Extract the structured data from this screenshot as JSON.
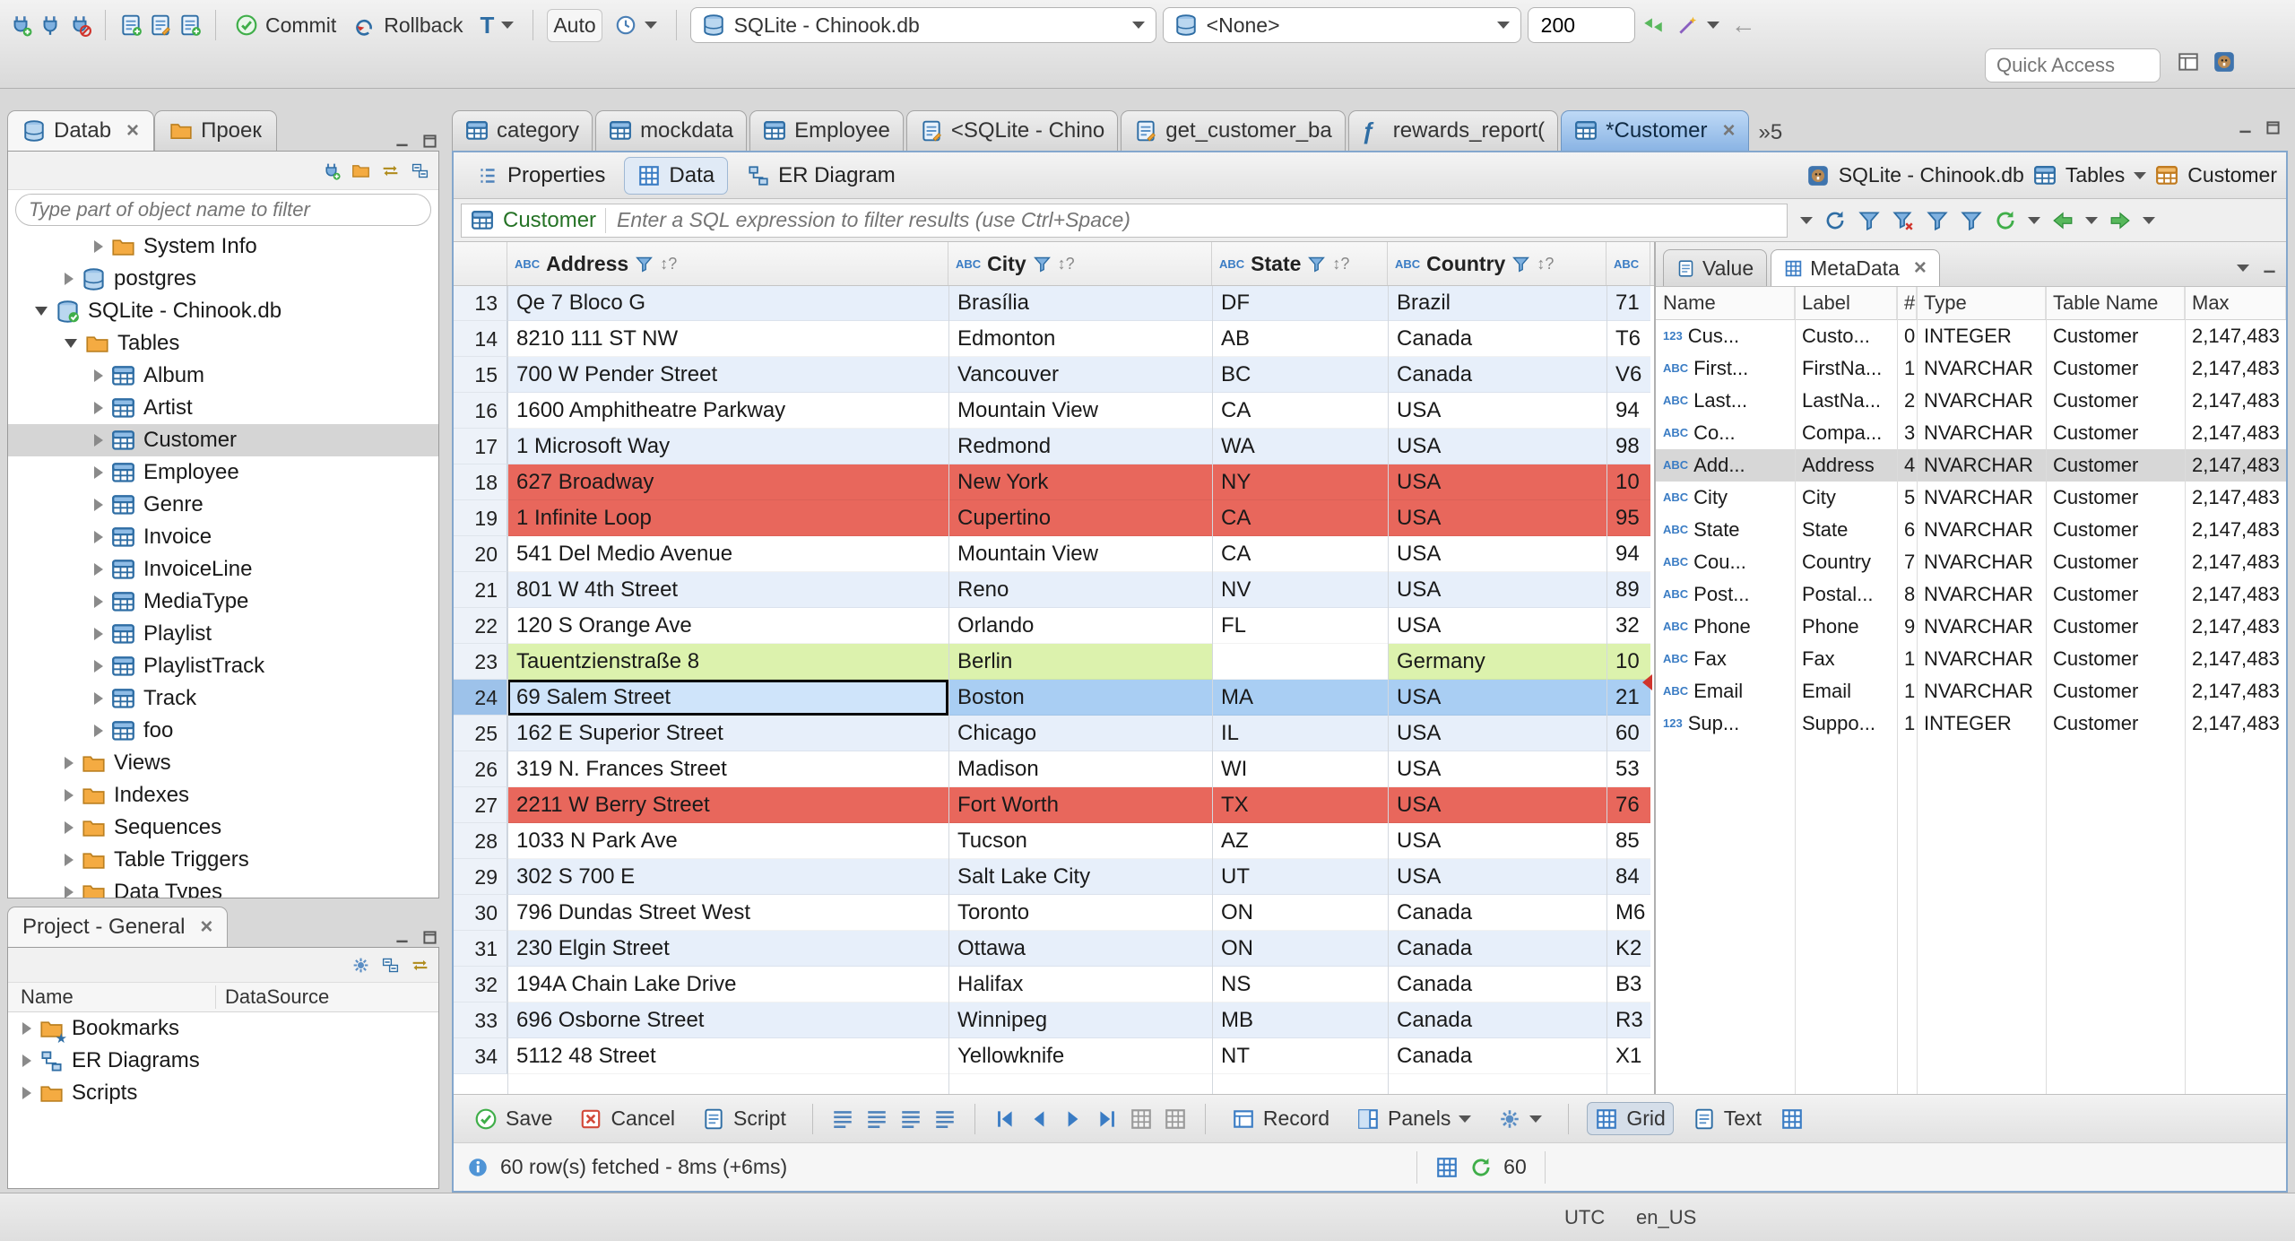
{
  "colors": {
    "accent": "#3a7cc4",
    "row_alt": "#e7effa",
    "row_red": "#e8675c",
    "row_green": "#dcf2ad",
    "row_selected": "#a9cef3",
    "focus_cell": "#cfe4fa",
    "tab_active_top": "#bed9f6",
    "tab_active_bottom": "#8ab4e4"
  },
  "window": {
    "status_items": [
      "UTC",
      "en_US"
    ]
  },
  "main_toolbar": {
    "commit": "Commit",
    "rollback": "Rollback",
    "txn_mode": "T",
    "auto_commit_mode": "Auto",
    "database": "SQLite - Chinook.db",
    "schema": "<None>",
    "fetch_size": "200",
    "quick_access_placeholder": "Quick Access"
  },
  "navigator": {
    "tab_database": "Datab",
    "tab_projects": "Проек",
    "filter_placeholder": "Type part of object name to filter",
    "tree": [
      {
        "label": "System Info",
        "icon": "folder",
        "level": 2
      },
      {
        "label": "postgres",
        "icon": "db",
        "level": 1
      },
      {
        "label": "SQLite - Chinook.db",
        "icon": "db-check",
        "level": 0,
        "expanded": true
      },
      {
        "label": "Tables",
        "icon": "folder",
        "level": 1,
        "expanded": true
      },
      {
        "label": "Album",
        "icon": "table",
        "level": 2
      },
      {
        "label": "Artist",
        "icon": "table",
        "level": 2
      },
      {
        "label": "Customer",
        "icon": "table",
        "level": 2,
        "selected": true
      },
      {
        "label": "Employee",
        "icon": "table",
        "level": 2
      },
      {
        "label": "Genre",
        "icon": "table",
        "level": 2
      },
      {
        "label": "Invoice",
        "icon": "table",
        "level": 2
      },
      {
        "label": "InvoiceLine",
        "icon": "table",
        "level": 2
      },
      {
        "label": "MediaType",
        "icon": "table",
        "level": 2
      },
      {
        "label": "Playlist",
        "icon": "table",
        "level": 2
      },
      {
        "label": "PlaylistTrack",
        "icon": "table",
        "level": 2
      },
      {
        "label": "Track",
        "icon": "table",
        "level": 2
      },
      {
        "label": "foo",
        "icon": "table",
        "level": 2
      },
      {
        "label": "Views",
        "icon": "folder",
        "level": 1
      },
      {
        "label": "Indexes",
        "icon": "folder",
        "level": 1
      },
      {
        "label": "Sequences",
        "icon": "folder",
        "level": 1
      },
      {
        "label": "Table Triggers",
        "icon": "folder",
        "level": 1
      },
      {
        "label": "Data Types",
        "icon": "folder",
        "level": 1
      }
    ]
  },
  "projects_panel": {
    "title": "Project - General",
    "columns": [
      "Name",
      "DataSource"
    ],
    "rows": [
      {
        "label": "Bookmarks",
        "icon": "folder-star"
      },
      {
        "label": "ER Diagrams",
        "icon": "diagram"
      },
      {
        "label": "Scripts",
        "icon": "folder"
      }
    ]
  },
  "editor": {
    "tabs": [
      {
        "label": "category",
        "icon": "table"
      },
      {
        "label": "mockdata",
        "icon": "table"
      },
      {
        "label": "Employee",
        "icon": "table"
      },
      {
        "label": "<SQLite - Chino",
        "icon": "sql"
      },
      {
        "label": "get_customer_ba",
        "icon": "sql"
      },
      {
        "label": "rewards_report(",
        "icon": "function"
      },
      {
        "label": "*Customer",
        "icon": "table",
        "active": true,
        "closable": true
      }
    ],
    "tab_overflow": "»5",
    "subtabs": [
      {
        "label": "Properties",
        "icon": "properties"
      },
      {
        "label": "Data",
        "icon": "grid",
        "active": true
      },
      {
        "label": "ER Diagram",
        "icon": "diagram"
      }
    ],
    "context": {
      "database": "SQLite - Chinook.db",
      "container": "Tables",
      "entity": "Customer"
    },
    "filter": {
      "entity": "Customer",
      "placeholder": "Enter a SQL expression to filter results (use Ctrl+Space)"
    }
  },
  "grid": {
    "sort_indicator": "↕?",
    "type_icons": {
      "text": "ABC",
      "number": "123"
    },
    "columns": [
      "Address",
      "City",
      "State",
      "Country",
      ""
    ],
    "rows": [
      {
        "n": 13,
        "bg": "alt",
        "cells": [
          "Qe 7 Bloco G",
          "Brasília",
          "DF",
          "Brazil",
          "71"
        ]
      },
      {
        "n": 14,
        "bg": "plain",
        "cells": [
          "8210 111 ST NW",
          "Edmonton",
          "AB",
          "Canada",
          "T6"
        ]
      },
      {
        "n": 15,
        "bg": "alt",
        "cells": [
          "700 W Pender Street",
          "Vancouver",
          "BC",
          "Canada",
          "V6"
        ]
      },
      {
        "n": 16,
        "bg": "plain",
        "cells": [
          "1600 Amphitheatre Parkway",
          "Mountain View",
          "CA",
          "USA",
          "94"
        ]
      },
      {
        "n": 17,
        "bg": "alt",
        "cells": [
          "1 Microsoft Way",
          "Redmond",
          "WA",
          "USA",
          "98"
        ]
      },
      {
        "n": 18,
        "bg": "red",
        "cells": [
          "627 Broadway",
          "New York",
          "NY",
          "USA",
          "10"
        ]
      },
      {
        "n": 19,
        "bg": "red",
        "cells": [
          "1 Infinite Loop",
          "Cupertino",
          "CA",
          "USA",
          "95"
        ]
      },
      {
        "n": 20,
        "bg": "plain",
        "cells": [
          "541 Del Medio Avenue",
          "Mountain View",
          "CA",
          "USA",
          "94"
        ]
      },
      {
        "n": 21,
        "bg": "alt",
        "cells": [
          "801 W 4th Street",
          "Reno",
          "NV",
          "USA",
          "89"
        ]
      },
      {
        "n": 22,
        "bg": "plain",
        "cells": [
          "120 S Orange Ave",
          "Orlando",
          "FL",
          "USA",
          "32"
        ]
      },
      {
        "n": 23,
        "bg": "green",
        "cells": [
          "Tauentzienstraße 8",
          "Berlin",
          "",
          "Germany",
          "10"
        ]
      },
      {
        "n": 24,
        "bg": "selected",
        "focus": 0,
        "cells": [
          "69 Salem Street",
          "Boston",
          "MA",
          "USA",
          "21"
        ]
      },
      {
        "n": 25,
        "bg": "alt",
        "cells": [
          "162 E Superior Street",
          "Chicago",
          "IL",
          "USA",
          "60"
        ]
      },
      {
        "n": 26,
        "bg": "plain",
        "cells": [
          "319 N. Frances Street",
          "Madison",
          "WI",
          "USA",
          "53"
        ]
      },
      {
        "n": 27,
        "bg": "red",
        "cells": [
          "2211 W Berry Street",
          "Fort Worth",
          "TX",
          "USA",
          "76"
        ]
      },
      {
        "n": 28,
        "bg": "plain",
        "cells": [
          "1033 N Park Ave",
          "Tucson",
          "AZ",
          "USA",
          "85"
        ]
      },
      {
        "n": 29,
        "bg": "alt",
        "cells": [
          "302 S 700 E",
          "Salt Lake City",
          "UT",
          "USA",
          "84"
        ]
      },
      {
        "n": 30,
        "bg": "plain",
        "cells": [
          "796 Dundas Street West",
          "Toronto",
          "ON",
          "Canada",
          "M6"
        ]
      },
      {
        "n": 31,
        "bg": "alt",
        "cells": [
          "230 Elgin Street",
          "Ottawa",
          "ON",
          "Canada",
          "K2"
        ]
      },
      {
        "n": 32,
        "bg": "plain",
        "cells": [
          "194A Chain Lake Drive",
          "Halifax",
          "NS",
          "Canada",
          "B3"
        ]
      },
      {
        "n": 33,
        "bg": "alt",
        "cells": [
          "696 Osborne Street",
          "Winnipeg",
          "MB",
          "Canada",
          "R3"
        ]
      },
      {
        "n": 34,
        "bg": "plain",
        "cells": [
          "5112 48 Street",
          "Yellowknife",
          "NT",
          "Canada",
          "X1"
        ]
      }
    ]
  },
  "metadata_panel": {
    "tab_value": "Value",
    "tab_metadata": "MetaData",
    "columns": [
      "Name",
      "Label",
      "#",
      "Type",
      "Table Name",
      "Max"
    ],
    "rows": [
      {
        "icon": "number",
        "name": "Cus...",
        "label": "Custo...",
        "ord": "0",
        "type": "INTEGER",
        "table": "Customer",
        "max": "2,147,483"
      },
      {
        "icon": "text",
        "name": "First...",
        "label": "FirstNa...",
        "ord": "1",
        "type": "NVARCHAR",
        "table": "Customer",
        "max": "2,147,483"
      },
      {
        "icon": "text",
        "name": "Last...",
        "label": "LastNa...",
        "ord": "2",
        "type": "NVARCHAR",
        "table": "Customer",
        "max": "2,147,483"
      },
      {
        "icon": "text",
        "name": "Co...",
        "label": "Compa...",
        "ord": "3",
        "type": "NVARCHAR",
        "table": "Customer",
        "max": "2,147,483"
      },
      {
        "icon": "text",
        "name": "Add...",
        "label": "Address",
        "ord": "4",
        "type": "NVARCHAR",
        "table": "Customer",
        "max": "2,147,483",
        "selected": true
      },
      {
        "icon": "text",
        "name": "City",
        "label": "City",
        "ord": "5",
        "type": "NVARCHAR",
        "table": "Customer",
        "max": "2,147,483"
      },
      {
        "icon": "text",
        "name": "State",
        "label": "State",
        "ord": "6",
        "type": "NVARCHAR",
        "table": "Customer",
        "max": "2,147,483"
      },
      {
        "icon": "text",
        "name": "Cou...",
        "label": "Country",
        "ord": "7",
        "type": "NVARCHAR",
        "table": "Customer",
        "max": "2,147,483"
      },
      {
        "icon": "text",
        "name": "Post...",
        "label": "Postal...",
        "ord": "8",
        "type": "NVARCHAR",
        "table": "Customer",
        "max": "2,147,483"
      },
      {
        "icon": "text",
        "name": "Phone",
        "label": "Phone",
        "ord": "9",
        "type": "NVARCHAR",
        "table": "Customer",
        "max": "2,147,483"
      },
      {
        "icon": "text",
        "name": "Fax",
        "label": "Fax",
        "ord": "1",
        "type": "NVARCHAR",
        "table": "Customer",
        "max": "2,147,483"
      },
      {
        "icon": "text",
        "name": "Email",
        "label": "Email",
        "ord": "1",
        "type": "NVARCHAR",
        "table": "Customer",
        "max": "2,147,483"
      },
      {
        "icon": "number",
        "name": "Sup...",
        "label": "Suppo...",
        "ord": "1",
        "type": "INTEGER",
        "table": "Customer",
        "max": "2,147,483"
      }
    ]
  },
  "result_toolbar": {
    "save": "Save",
    "cancel": "Cancel",
    "script": "Script",
    "record": "Record",
    "panels": "Panels",
    "grid": "Grid",
    "text": "Text"
  },
  "status": {
    "fetch_info": "60 row(s) fetched - 8ms (+6ms)",
    "auto_refresh": "60"
  }
}
